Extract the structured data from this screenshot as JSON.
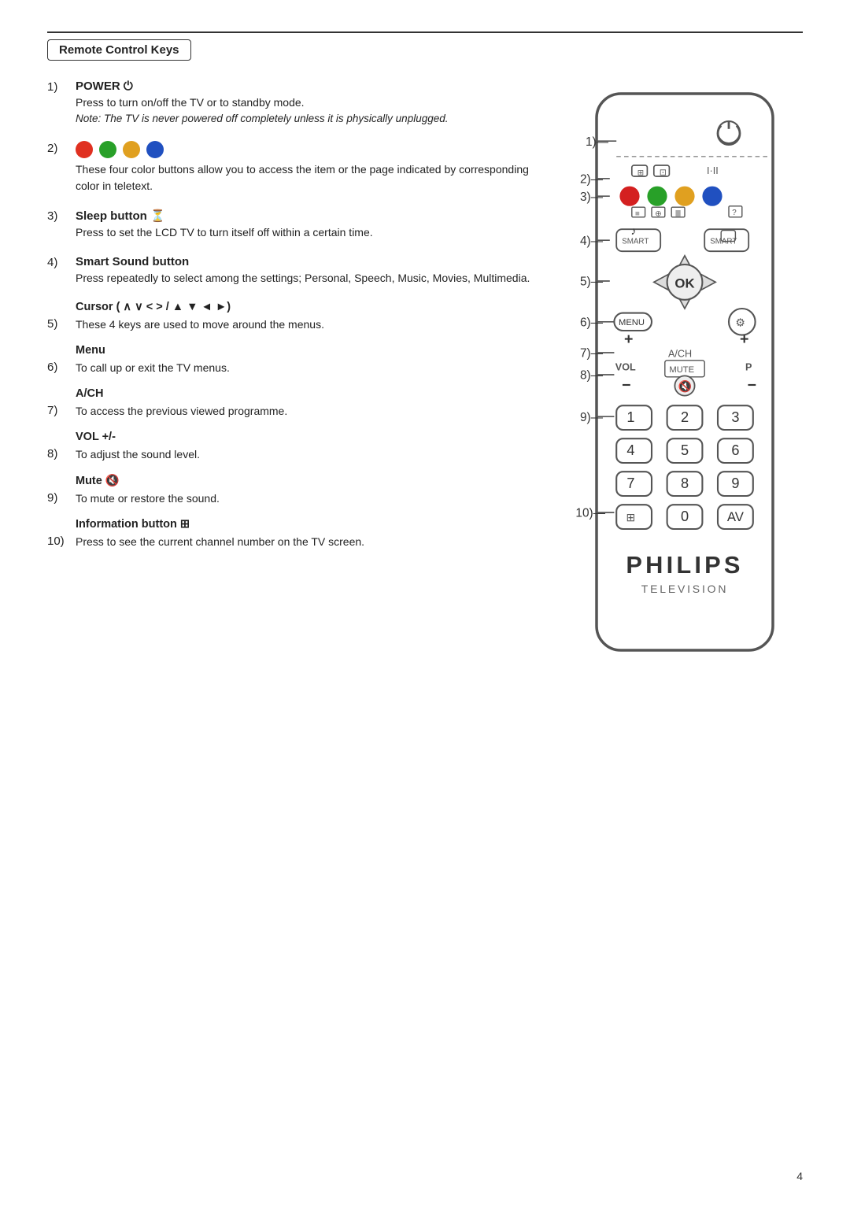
{
  "page": {
    "number": "4",
    "section_title": "Remote Control Keys"
  },
  "items": [
    {
      "num": "1)",
      "heading": "POWER ⏻",
      "desc": "Press to turn on/off the TV or to standby mode.",
      "note": "Note: The TV is never powered off completely unless it is physically unplugged."
    },
    {
      "num": "2)",
      "heading": "",
      "desc": "These four color buttons allow you to access the item or the page indicated by corresponding color in teletext."
    },
    {
      "num": "3)",
      "heading": "Sleep button 🕐",
      "desc": "Press to set the LCD TV to turn itself off within a certain time."
    },
    {
      "num": "4)",
      "heading": "Smart Sound button",
      "desc": "Press repeatedly to select among the settings; Personal, Speech, Music, Movies,  Multimedia."
    },
    {
      "sub_heading": "Cursor ( ∧ ∨ < > / ▲ ▼ ◄ ►)",
      "num": "5)",
      "desc": "These 4 keys are used to move around the menus."
    },
    {
      "sub_heading": "Menu",
      "num": "6)",
      "desc": "To call up or exit the TV menus."
    },
    {
      "sub_heading": "A/CH",
      "num": "7)",
      "desc": "To access the previous viewed programme."
    },
    {
      "sub_heading": "VOL +/-",
      "num": "8)",
      "desc": "To adjust the sound level."
    },
    {
      "sub_heading": "Mute 🔇",
      "num": "9)",
      "desc": "To mute or restore the sound."
    },
    {
      "sub_heading": "Information button ⊞",
      "num": "10)",
      "desc": "Press to see the current channel number on the TV screen."
    }
  ],
  "remote": {
    "brand": "PHILIPS",
    "subtitle": "TELEVISION"
  }
}
